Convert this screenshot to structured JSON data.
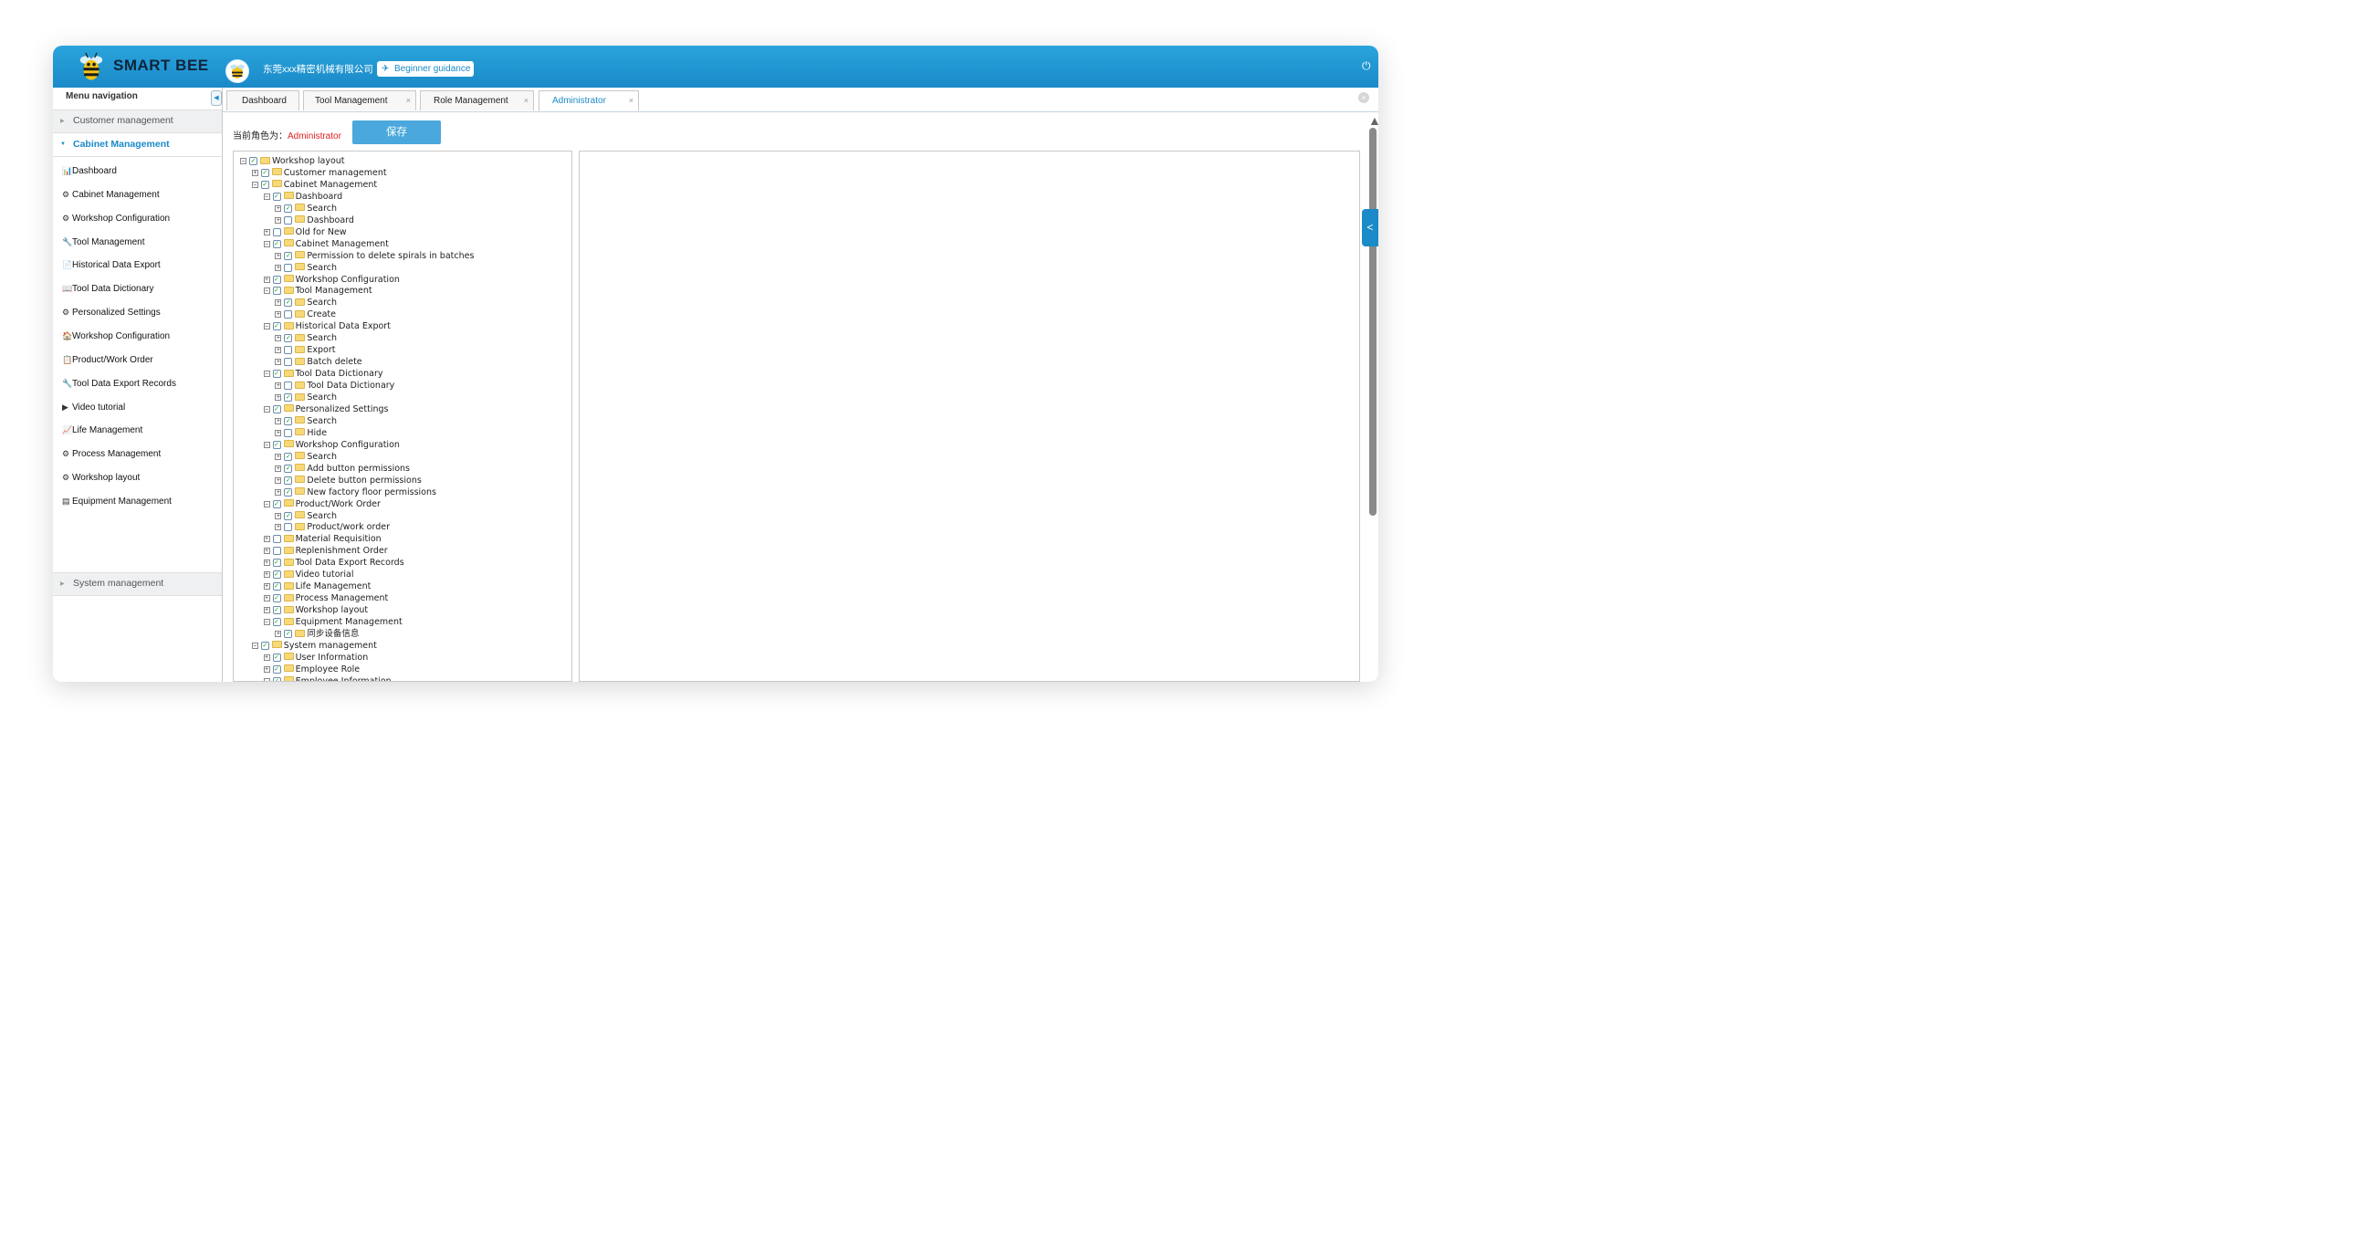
{
  "header": {
    "logo_text": "SMART BEE",
    "company": "东莞xxx精密机械有限公司",
    "guide_label": "Beginner guidance"
  },
  "sidebar": {
    "title": "Menu navigation",
    "groups": {
      "customer": "Customer management",
      "cabinet": "Cabinet Management",
      "system": "System management"
    },
    "items": [
      {
        "icon": "📊",
        "label": "Dashboard"
      },
      {
        "icon": "⚙",
        "label": "Cabinet Management"
      },
      {
        "icon": "⚙",
        "label": "Workshop Configuration"
      },
      {
        "icon": "🔧",
        "label": "Tool Management"
      },
      {
        "icon": "📄",
        "label": "Historical Data Export"
      },
      {
        "icon": "📖",
        "label": "Tool Data Dictionary"
      },
      {
        "icon": "⚙",
        "label": "Personalized Settings"
      },
      {
        "icon": "🏠",
        "label": "Workshop Configuration"
      },
      {
        "icon": "📋",
        "label": "Product/Work Order"
      },
      {
        "icon": "🔧",
        "label": "Tool Data Export Records"
      },
      {
        "icon": "▶",
        "label": "Video tutorial"
      },
      {
        "icon": "📈",
        "label": "Life Management"
      },
      {
        "icon": "⚙",
        "label": "Process Management"
      },
      {
        "icon": "⚙",
        "label": "Workshop layout"
      },
      {
        "icon": "▤",
        "label": "Equipment Management"
      }
    ]
  },
  "tabs": [
    {
      "label": "Dashboard",
      "closable": false,
      "active": false
    },
    {
      "label": "Tool Management",
      "closable": true,
      "active": false
    },
    {
      "label": "Role Management",
      "closable": true,
      "active": false
    },
    {
      "label": "Administrator",
      "closable": true,
      "active": true
    }
  ],
  "content": {
    "role_prefix": "当前角色为：",
    "role_name": "Administrator",
    "save_label": "保存"
  },
  "tree": [
    {
      "d": 0,
      "t": "−",
      "c": true,
      "label": "Workshop layout"
    },
    {
      "d": 1,
      "t": "+",
      "c": true,
      "label": "Customer management"
    },
    {
      "d": 1,
      "t": "−",
      "c": true,
      "label": "Cabinet Management"
    },
    {
      "d": 2,
      "t": "−",
      "c": true,
      "label": "Dashboard"
    },
    {
      "d": 3,
      "t": "+",
      "c": true,
      "label": "Search"
    },
    {
      "d": 3,
      "t": "+",
      "c": false,
      "label": "Dashboard"
    },
    {
      "d": 2,
      "t": "+",
      "c": false,
      "label": "Old for New"
    },
    {
      "d": 2,
      "t": "−",
      "c": true,
      "label": "Cabinet Management"
    },
    {
      "d": 3,
      "t": "+",
      "c": true,
      "label": "Permission to delete spirals in batches"
    },
    {
      "d": 3,
      "t": "+",
      "c": false,
      "label": "Search"
    },
    {
      "d": 2,
      "t": "+",
      "c": true,
      "label": "Workshop Configuration"
    },
    {
      "d": 2,
      "t": "−",
      "c": true,
      "label": "Tool Management"
    },
    {
      "d": 3,
      "t": "+",
      "c": true,
      "label": "Search"
    },
    {
      "d": 3,
      "t": "+",
      "c": false,
      "label": "Create"
    },
    {
      "d": 2,
      "t": "−",
      "c": true,
      "label": "Historical Data Export"
    },
    {
      "d": 3,
      "t": "+",
      "c": true,
      "label": "Search"
    },
    {
      "d": 3,
      "t": "+",
      "c": false,
      "label": "Export"
    },
    {
      "d": 3,
      "t": "+",
      "c": false,
      "label": "Batch delete"
    },
    {
      "d": 2,
      "t": "−",
      "c": true,
      "label": "Tool Data Dictionary"
    },
    {
      "d": 3,
      "t": "+",
      "c": false,
      "label": "Tool Data Dictionary"
    },
    {
      "d": 3,
      "t": "+",
      "c": true,
      "label": "Search"
    },
    {
      "d": 2,
      "t": "−",
      "c": true,
      "label": "Personalized Settings"
    },
    {
      "d": 3,
      "t": "+",
      "c": true,
      "label": "Search"
    },
    {
      "d": 3,
      "t": "+",
      "c": false,
      "label": "Hide"
    },
    {
      "d": 2,
      "t": "−",
      "c": true,
      "label": "Workshop Configuration"
    },
    {
      "d": 3,
      "t": "+",
      "c": true,
      "label": "Search"
    },
    {
      "d": 3,
      "t": "+",
      "c": true,
      "label": "Add button permissions"
    },
    {
      "d": 3,
      "t": "+",
      "c": true,
      "label": "Delete button permissions"
    },
    {
      "d": 3,
      "t": "+",
      "c": true,
      "label": "New factory floor permissions"
    },
    {
      "d": 2,
      "t": "−",
      "c": true,
      "label": "Product/Work Order"
    },
    {
      "d": 3,
      "t": "+",
      "c": true,
      "label": "Search"
    },
    {
      "d": 3,
      "t": "+",
      "c": false,
      "label": "Product/work order"
    },
    {
      "d": 2,
      "t": "+",
      "c": false,
      "label": "Material Requisition"
    },
    {
      "d": 2,
      "t": "+",
      "c": false,
      "label": "Replenishment Order"
    },
    {
      "d": 2,
      "t": "+",
      "c": true,
      "label": "Tool Data Export Records"
    },
    {
      "d": 2,
      "t": "+",
      "c": true,
      "label": "Video tutorial"
    },
    {
      "d": 2,
      "t": "+",
      "c": true,
      "label": "Life Management"
    },
    {
      "d": 2,
      "t": "+",
      "c": true,
      "label": "Process Management"
    },
    {
      "d": 2,
      "t": "+",
      "c": true,
      "label": "Workshop layout"
    },
    {
      "d": 2,
      "t": "−",
      "c": true,
      "label": "Equipment Management"
    },
    {
      "d": 3,
      "t": "+",
      "c": true,
      "label": "同步设备信息"
    },
    {
      "d": 1,
      "t": "−",
      "c": true,
      "label": "System management"
    },
    {
      "d": 2,
      "t": "+",
      "c": true,
      "label": "User Information"
    },
    {
      "d": 2,
      "t": "+",
      "c": true,
      "label": "Employee Role"
    },
    {
      "d": 2,
      "t": "−",
      "c": true,
      "label": "Employee Information"
    }
  ],
  "colors": {
    "accent": "#1a8ac8",
    "header": "#2aa4dc",
    "role_red": "#e02020",
    "save": "#4aa8dc"
  }
}
